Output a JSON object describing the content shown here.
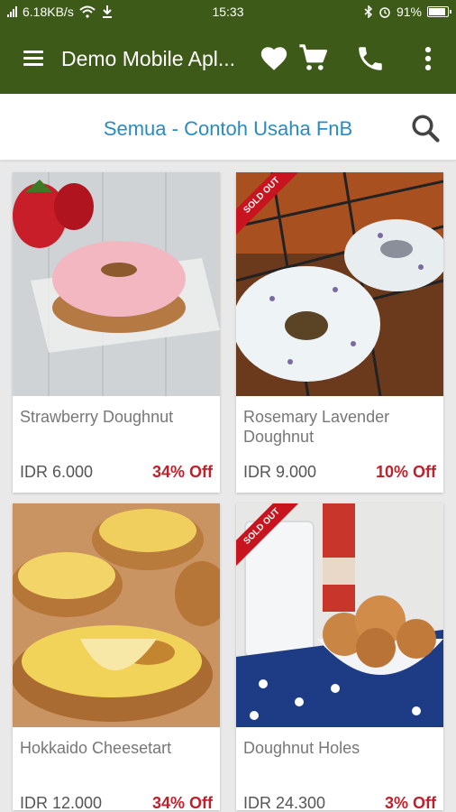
{
  "status": {
    "speed": "6.18KB/s",
    "time": "15:33",
    "battery": "91%"
  },
  "appbar": {
    "title": "Demo Mobile Apl..."
  },
  "category": {
    "label": "Semua - Contoh Usaha FnB"
  },
  "badge": {
    "sold_out": "SOLD OUT"
  },
  "products": [
    {
      "name": "Strawberry Doughnut",
      "price": "IDR 6.000",
      "discount": "34% Off"
    },
    {
      "name": "Rosemary Lavender Doughnut",
      "price": "IDR 9.000",
      "discount": "10% Off"
    },
    {
      "name": "Hokkaido Cheesetart",
      "price": "IDR 12.000",
      "discount": "34% Off"
    },
    {
      "name": "Doughnut Holes",
      "price": "IDR 24.300",
      "discount": "3% Off"
    }
  ],
  "colors": {
    "appbar": "#3d5a18",
    "accent": "#2b8bbf",
    "discount": "#c0202a",
    "sold_out": "#c8141e"
  },
  "icons": [
    "menu-icon",
    "heart-icon",
    "cart-icon",
    "phone-icon",
    "more-vert-icon",
    "search-icon"
  ]
}
